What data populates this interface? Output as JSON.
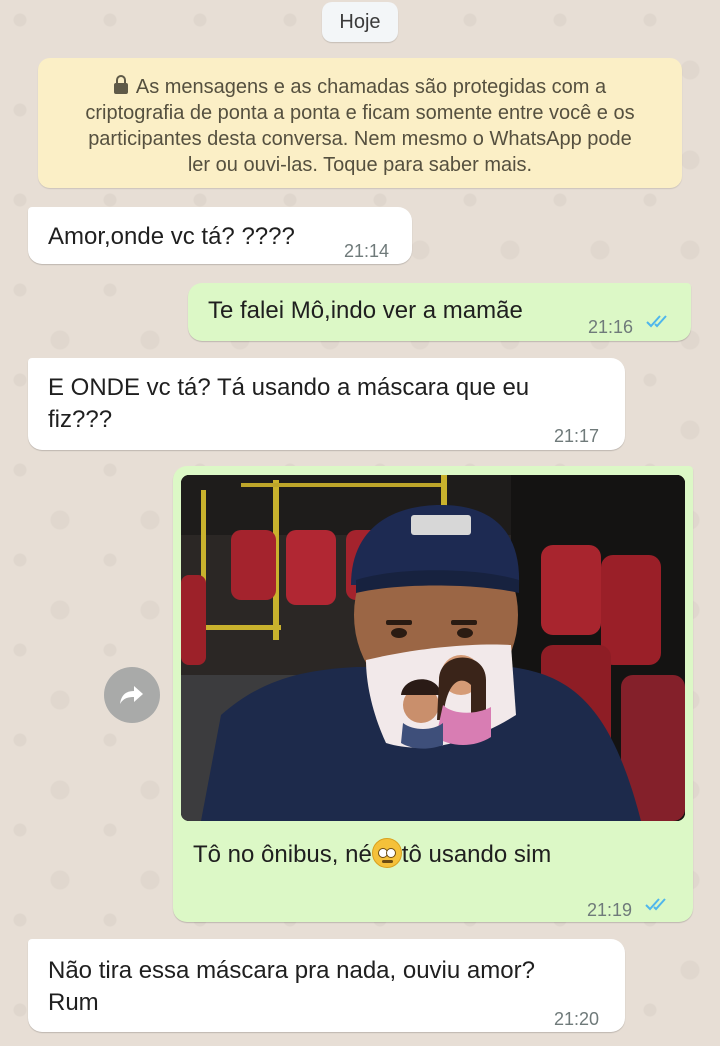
{
  "date_chip": "Hoje",
  "encryption_notice": {
    "line1": "As mensagens e as chamadas são protegidas com a",
    "line2": "criptografia de ponta a ponta e ficam somente entre você e os",
    "line3": "participantes desta conversa. Nem mesmo o WhatsApp pode",
    "line4": "ler ou ouvi-las. Toque para saber mais."
  },
  "messages": [
    {
      "direction": "incoming",
      "text": "Amor,onde vc tá? ????",
      "time": "21:14"
    },
    {
      "direction": "outgoing",
      "text": "Te falei Mô,indo ver a mamãe",
      "time": "21:16",
      "status": "read"
    },
    {
      "direction": "incoming",
      "line1": "E ONDE vc tá?  Tá usando a máscara que eu",
      "line2": "fiz???",
      "time": "21:17"
    },
    {
      "direction": "outgoing",
      "type": "image",
      "caption_before": "Tô no ônibus, né",
      "emoji": "face-with-rolling-eyes",
      "caption_after": "tô usando sim",
      "time": "21:19",
      "status": "read"
    },
    {
      "direction": "incoming",
      "line1": "Não tira essa máscara pra nada, ouviu amor?",
      "line2": "Rum",
      "time": "21:20"
    }
  ],
  "colors": {
    "chat_background": "#e7ded5",
    "incoming_bubble": "#ffffff",
    "outgoing_bubble": "#dcf8c6",
    "encryption_banner": "#fbefc6",
    "read_ticks": "#4fb6ec"
  },
  "icons": {
    "lock": "lock-icon",
    "forward": "forward-icon",
    "read_receipt": "double-check-icon"
  }
}
